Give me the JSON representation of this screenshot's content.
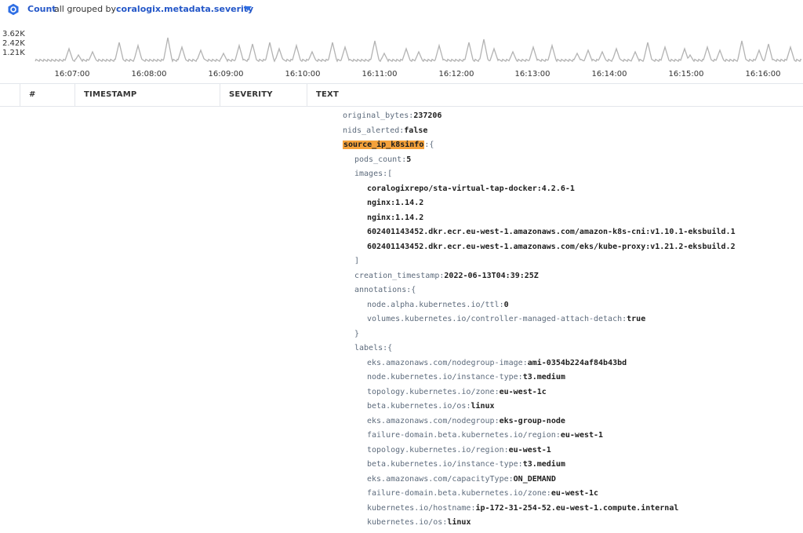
{
  "header": {
    "count_label": "Count",
    "mid_text": "all grouped by",
    "field": "coralogix.metadata.severity"
  },
  "histogram": {
    "y_labels": [
      "3.62K",
      "2.42K",
      "1.21K"
    ],
    "x_labels": [
      "16:07:00",
      "16:08:00",
      "16:09:00",
      "16:10:00",
      "16:11:00",
      "16:12:00",
      "16:13:00",
      "16:14:00",
      "16:15:00",
      "16:16:00"
    ],
    "line_color": "#b3b3b3"
  },
  "table": {
    "columns": [
      "#",
      "TIMESTAMP",
      "SEVERITY",
      "TEXT"
    ]
  },
  "log_lines": [
    {
      "indent": 0,
      "key": "original_bytes",
      "sep": ":",
      "value": "237206"
    },
    {
      "indent": 0,
      "key": "nids_alerted",
      "sep": ":",
      "value": "false"
    },
    {
      "indent": 0,
      "key": "source_ip_k8sinfo",
      "sep": ":",
      "value": "{",
      "highlight": true
    },
    {
      "indent": 1,
      "key": "pods_count",
      "sep": ":",
      "value": "5"
    },
    {
      "indent": 1,
      "key": "images",
      "sep": ":",
      "value": "["
    },
    {
      "indent": 2,
      "key": "",
      "sep": "",
      "value": "coralogixrepo/sta-virtual-tap-docker:4.2.6-1"
    },
    {
      "indent": 2,
      "key": "",
      "sep": "",
      "value": "nginx:1.14.2"
    },
    {
      "indent": 2,
      "key": "",
      "sep": "",
      "value": "nginx:1.14.2"
    },
    {
      "indent": 2,
      "key": "",
      "sep": "",
      "value": "602401143452.dkr.ecr.eu-west-1.amazonaws.com/amazon-k8s-cni:v1.10.1-eksbuild.1"
    },
    {
      "indent": 2,
      "key": "",
      "sep": "",
      "value": "602401143452.dkr.ecr.eu-west-1.amazonaws.com/eks/kube-proxy:v1.21.2-eksbuild.2"
    },
    {
      "indent": 1,
      "key": "",
      "sep": "",
      "value": "]",
      "punct": true
    },
    {
      "indent": 1,
      "key": "creation_timestamp",
      "sep": ":",
      "value": "2022-06-13T04:39:25Z"
    },
    {
      "indent": 1,
      "key": "annotations",
      "sep": ":",
      "value": "{"
    },
    {
      "indent": 2,
      "key": "node.alpha.kubernetes.io/ttl",
      "sep": ":",
      "value": "0"
    },
    {
      "indent": 2,
      "key": "volumes.kubernetes.io/controller-managed-attach-detach",
      "sep": ":",
      "value": "true"
    },
    {
      "indent": 1,
      "key": "",
      "sep": "",
      "value": "}",
      "punct": true
    },
    {
      "indent": 1,
      "key": "labels",
      "sep": ":",
      "value": "{"
    },
    {
      "indent": 2,
      "key": "eks.amazonaws.com/nodegroup-image",
      "sep": ":",
      "value": "ami-0354b224af84b43bd"
    },
    {
      "indent": 2,
      "key": "node.kubernetes.io/instance-type",
      "sep": ":",
      "value": "t3.medium"
    },
    {
      "indent": 2,
      "key": "topology.kubernetes.io/zone",
      "sep": ":",
      "value": "eu-west-1c"
    },
    {
      "indent": 2,
      "key": "beta.kubernetes.io/os",
      "sep": ":",
      "value": "linux"
    },
    {
      "indent": 2,
      "key": "eks.amazonaws.com/nodegroup",
      "sep": ":",
      "value": "eks-group-node"
    },
    {
      "indent": 2,
      "key": "failure-domain.beta.kubernetes.io/region",
      "sep": ":",
      "value": "eu-west-1"
    },
    {
      "indent": 2,
      "key": "topology.kubernetes.io/region",
      "sep": ":",
      "value": "eu-west-1"
    },
    {
      "indent": 2,
      "key": "beta.kubernetes.io/instance-type",
      "sep": ":",
      "value": "t3.medium"
    },
    {
      "indent": 2,
      "key": "eks.amazonaws.com/capacityType",
      "sep": ":",
      "value": "ON_DEMAND"
    },
    {
      "indent": 2,
      "key": "failure-domain.beta.kubernetes.io/zone",
      "sep": ":",
      "value": "eu-west-1c"
    },
    {
      "indent": 2,
      "key": "kubernetes.io/hostname",
      "sep": ":",
      "value": "ip-172-31-254-52.eu-west-1.compute.internal"
    },
    {
      "indent": 2,
      "key": "kubernetes.io/os",
      "sep": ":",
      "value": "linux"
    }
  ]
}
